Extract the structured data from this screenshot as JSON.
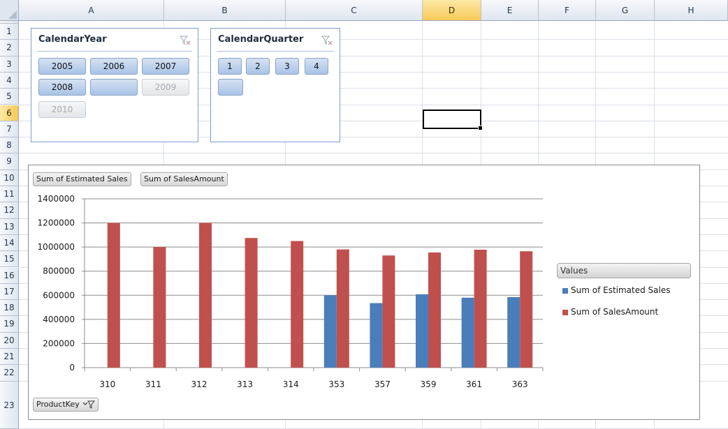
{
  "sheet": {
    "columns": [
      "A",
      "B",
      "C",
      "D",
      "E",
      "F",
      "G",
      "H"
    ],
    "selected_column": "D",
    "rows": [
      "1",
      "2",
      "3",
      "4",
      "5",
      "6",
      "7",
      "8",
      "9",
      "10",
      "11",
      "12",
      "13",
      "14",
      "15",
      "16",
      "17",
      "18",
      "19",
      "20",
      "21",
      "22",
      "23"
    ],
    "selected_row": "6"
  },
  "slicer_year": {
    "title": "CalendarYear",
    "items": [
      {
        "label": "2005",
        "state": "selected"
      },
      {
        "label": "2006",
        "state": "selected"
      },
      {
        "label": "2007",
        "state": "selected"
      },
      {
        "label": "2008",
        "state": "selected"
      },
      {
        "label": "",
        "state": "selected"
      },
      {
        "label": "2009",
        "state": "nodata"
      },
      {
        "label": "2010",
        "state": "nodata"
      }
    ]
  },
  "slicer_quarter": {
    "title": "CalendarQuarter",
    "items": [
      {
        "label": "1",
        "state": "selected"
      },
      {
        "label": "2",
        "state": "selected"
      },
      {
        "label": "3",
        "state": "selected"
      },
      {
        "label": "4",
        "state": "selected"
      },
      {
        "label": "",
        "state": "selected"
      }
    ]
  },
  "chart": {
    "value_buttons": [
      "Sum of Estimated Sales",
      "Sum of SalesAmount"
    ],
    "axis_button": "ProductKey",
    "legend_header": "Values"
  },
  "chart_data": {
    "type": "bar",
    "categories": [
      "310",
      "311",
      "312",
      "313",
      "314",
      "353",
      "357",
      "359",
      "361",
      "363"
    ],
    "series": [
      {
        "name": "Sum of Estimated Sales",
        "color": "#4a7ebb",
        "values": [
          0,
          0,
          0,
          0,
          0,
          600000,
          535000,
          608000,
          580000,
          585000
        ]
      },
      {
        "name": "Sum of SalesAmount",
        "color": "#c0504d",
        "values": [
          1200000,
          1000000,
          1200000,
          1075000,
          1050000,
          980000,
          930000,
          955000,
          978000,
          965000
        ]
      }
    ],
    "ylim": [
      0,
      1400000
    ],
    "yticks": [
      "0",
      "200000",
      "400000",
      "600000",
      "800000",
      "1000000",
      "1200000",
      "1400000"
    ],
    "grid": true,
    "legend": "right"
  }
}
